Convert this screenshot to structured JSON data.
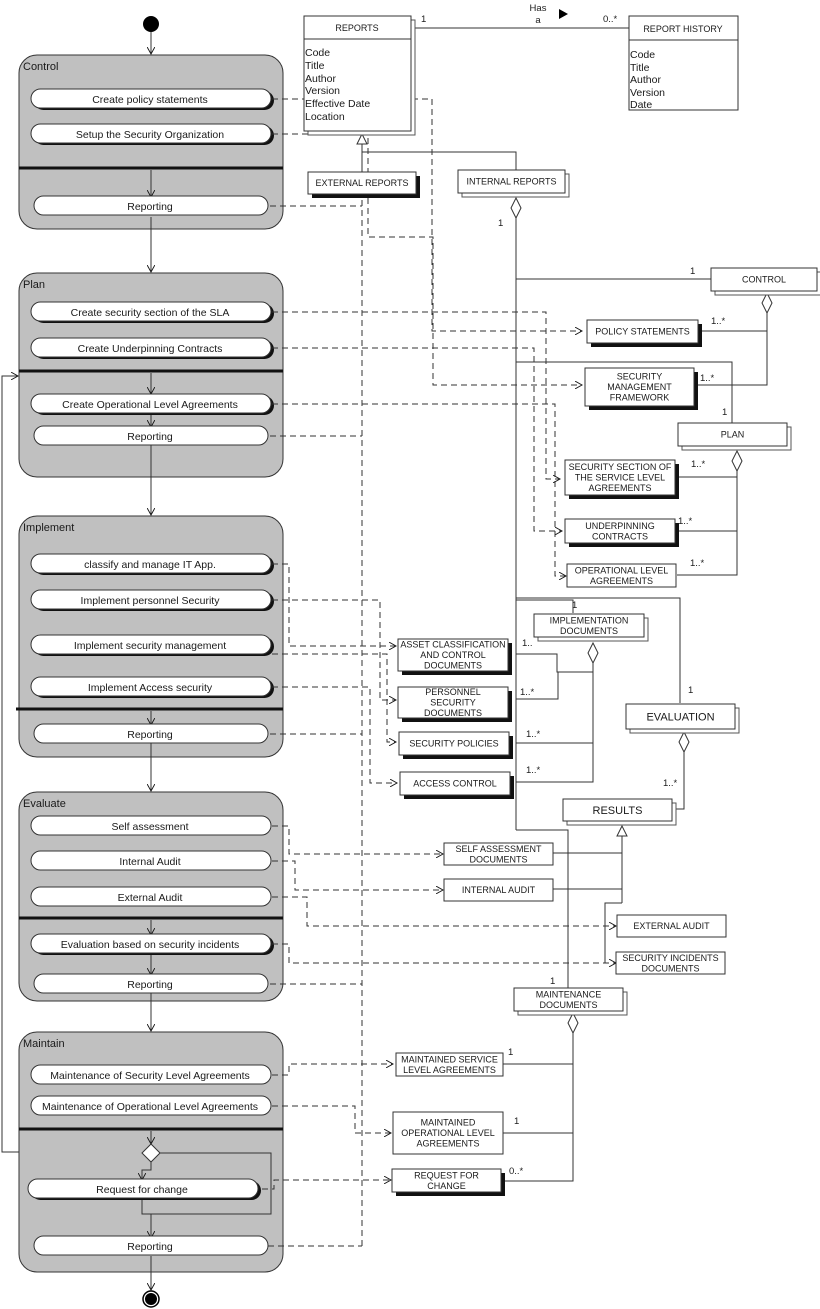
{
  "diagram": {
    "type": "UML activity diagram with class diagram (Security Management process)",
    "swimlanes": [
      {
        "id": "control",
        "label": "Control",
        "activities_before_bar": [
          "Create policy statements",
          "Setup the Security Organization"
        ],
        "activities_after_bar": [
          "Reporting"
        ]
      },
      {
        "id": "plan",
        "label": "Plan",
        "activities_before_bar": [
          "Create security section of the SLA",
          "Create Underpinning Contracts"
        ],
        "activities_after_bar": [
          "Create Operational Level Agreements",
          "Reporting"
        ]
      },
      {
        "id": "implement",
        "label": "Implement",
        "activities_before_bar": [
          "classify and manage IT App.",
          "Implement personnel Security",
          "Implement security management",
          "Implement Access security"
        ],
        "activities_after_bar": [
          "Reporting"
        ]
      },
      {
        "id": "evaluate",
        "label": "Evaluate",
        "activities_before_bar": [
          "Self assessment",
          "Internal Audit",
          "External Audit"
        ],
        "activities_after_bar": [
          "Evaluation based on security incidents",
          "Reporting"
        ]
      },
      {
        "id": "maintain",
        "label": "Maintain",
        "activities_before_bar": [
          "Maintenance of Security Level Agreements",
          "Maintenance of Operational Level Agreements"
        ],
        "activities_after_bar": [
          "Request for change",
          "Reporting"
        ]
      }
    ],
    "classes": {
      "reports": {
        "title": "REPORTS",
        "attributes": [
          "Code",
          "Title",
          "Author",
          "Version",
          "Effective Date",
          "Location"
        ]
      },
      "report_history": {
        "title": "REPORT HISTORY",
        "attributes": [
          "Code",
          "Title",
          "Author",
          "Version",
          "Date"
        ]
      },
      "association": {
        "label_line1": "Has",
        "label_line2": "a",
        "mult_left": "1",
        "mult_right": "0..*"
      },
      "external_reports": "EXTERNAL REPORTS",
      "internal_reports": "INTERNAL REPORTS",
      "control": "CONTROL",
      "policy_statements": "POLICY  STATEMENTS",
      "security_management_framework": [
        "SECURITY",
        "MANAGEMENT",
        "FRAMEWORK"
      ],
      "plan": "PLAN",
      "security_section_sla": [
        "SECURITY SECTION OF",
        "THE SERVICE LEVEL",
        "AGREEMENTS"
      ],
      "underpinning_contracts": [
        "UNDERPINNING",
        "CONTRACTS"
      ],
      "operational_level_agreements": [
        "OPERATIONAL LEVEL",
        "AGREEMENTS"
      ],
      "implementation_documents": [
        "IMPLEMENTATION",
        "DOCUMENTS"
      ],
      "asset_classification": [
        "ASSET CLASSIFICATION",
        "AND CONTROL",
        "DOCUMENTS"
      ],
      "personnel_security": [
        "PERSONNEL",
        "SECURITY",
        "DOCUMENTS"
      ],
      "security_policies": "SECURITY POLICIES",
      "access_control": "ACCESS CONTROL",
      "evaluation": "EVALUATION",
      "results": "RESULTS",
      "self_assessment_docs": [
        "SELF ASSESSMENT",
        "DOCUMENTS"
      ],
      "internal_audit": "INTERNAL AUDIT",
      "external_audit": "EXTERNAL AUDIT",
      "security_incidents_docs": [
        "SECURITY INCIDENTS",
        "DOCUMENTS"
      ],
      "maintenance_documents": [
        "MAINTENANCE",
        "DOCUMENTS"
      ],
      "maintained_sla": [
        "MAINTAINED SERVICE",
        "LEVEL AGREEMENTS"
      ],
      "maintained_ola": [
        "MAINTAINED",
        "OPERATIONAL LEVEL",
        "AGREEMENTS"
      ],
      "request_for_change": [
        "REQUEST FOR",
        "CHANGE"
      ]
    },
    "multiplicities": {
      "internal_reports": "1",
      "control": "1",
      "policy_statements": "1..*",
      "security_management_framework": "1..*",
      "plan": "1",
      "security_section_sla": "1..*",
      "underpinning_contracts": "1..*",
      "operational_level_agreements": "1..*",
      "implementation_documents": "1",
      "asset_classification": "1..",
      "personnel_security": "1..*",
      "security_policies": "1..*",
      "access_control": "1..*",
      "evaluation": "1",
      "results": "1..*",
      "maintenance_documents": "1",
      "maintained_sla": "1",
      "maintained_ola": "1",
      "request_for_change": "0..*"
    },
    "colors": {
      "swimlane_fill": "#c0c0c0",
      "activity_fill": "#ffffff",
      "line": "#1a1a1a",
      "shadow": "#111111"
    }
  }
}
